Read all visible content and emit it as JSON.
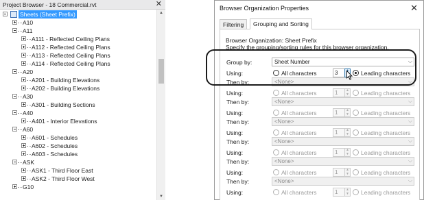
{
  "project_browser": {
    "title": "Project Browser - 18 Commercial.rvt",
    "close_glyph": "✕",
    "root_label": "Sheets (Sheet Prefix)",
    "tree": [
      {
        "label": "A10",
        "level": 1,
        "expanded": false
      },
      {
        "label": "A11",
        "level": 1,
        "expanded": true
      },
      {
        "label": "A111 - Reflected Ceiling Plans",
        "level": 2,
        "expanded": false
      },
      {
        "label": "A112 - Reflected Ceiling Plans",
        "level": 2,
        "expanded": false
      },
      {
        "label": "A113 - Reflected Ceiling Plans",
        "level": 2,
        "expanded": false
      },
      {
        "label": "A114 - Reflected Ceiling Plans",
        "level": 2,
        "expanded": false
      },
      {
        "label": "A20",
        "level": 1,
        "expanded": true
      },
      {
        "label": "A201 - Building Elevations",
        "level": 2,
        "expanded": false
      },
      {
        "label": "A202 - Building Elevations",
        "level": 2,
        "expanded": false
      },
      {
        "label": "A30",
        "level": 1,
        "expanded": true
      },
      {
        "label": "A301 - Building Sections",
        "level": 2,
        "expanded": false
      },
      {
        "label": "A40",
        "level": 1,
        "expanded": true
      },
      {
        "label": "A401 - Interior Elevations",
        "level": 2,
        "expanded": false
      },
      {
        "label": "A60",
        "level": 1,
        "expanded": true
      },
      {
        "label": "A601 - Schedules",
        "level": 2,
        "expanded": false
      },
      {
        "label": "A602 - Schedules",
        "level": 2,
        "expanded": false
      },
      {
        "label": "A603 - Schedules",
        "level": 2,
        "expanded": false
      },
      {
        "label": "ASK",
        "level": 1,
        "expanded": true
      },
      {
        "label": "ASK1 - Third Floor East",
        "level": 2,
        "expanded": false
      },
      {
        "label": "ASK2 - Third Floor West",
        "level": 2,
        "expanded": false
      },
      {
        "label": "G10",
        "level": 1,
        "expanded": false
      }
    ]
  },
  "dialog": {
    "title": "Browser Organization Properties",
    "close_glyph": "✕",
    "tabs": [
      {
        "label": "Filtering",
        "active": false
      },
      {
        "label": "Grouping and Sorting",
        "active": true
      }
    ],
    "description_line1": "Browser Organization: Sheet Prefix",
    "description_line2": "Specify the grouping/sorting rules for this browser organization.",
    "rows": [
      {
        "label": "Group by:",
        "value": "Sheet Number",
        "enabled": true
      },
      {
        "label": "Then by:",
        "value": "<None>",
        "enabled": false
      },
      {
        "label": "Then by:",
        "value": "<None>",
        "enabled": false
      },
      {
        "label": "Then by:",
        "value": "<None>",
        "enabled": false
      },
      {
        "label": "Then by:",
        "value": "<None>",
        "enabled": false
      },
      {
        "label": "Then by:",
        "value": "<None>",
        "enabled": false
      },
      {
        "label": "Then by:",
        "value": "<None>",
        "enabled": false
      }
    ],
    "using_rows": [
      {
        "label": "Using:",
        "all_label": "All characters",
        "count": "3",
        "leading_label": "Leading characters",
        "enabled": true,
        "selected": "leading"
      },
      {
        "label": "Using:",
        "all_label": "All characters",
        "count": "1",
        "leading_label": "Leading characters",
        "enabled": false,
        "selected": "all"
      },
      {
        "label": "Using:",
        "all_label": "All characters",
        "count": "1",
        "leading_label": "Leading characters",
        "enabled": false,
        "selected": "all"
      },
      {
        "label": "Using:",
        "all_label": "All characters",
        "count": "1",
        "leading_label": "Leading characters",
        "enabled": false,
        "selected": "all"
      },
      {
        "label": "Using:",
        "all_label": "All characters",
        "count": "1",
        "leading_label": "Leading characters",
        "enabled": false,
        "selected": "all"
      },
      {
        "label": "Using:",
        "all_label": "All characters",
        "count": "1",
        "leading_label": "Leading characters",
        "enabled": false,
        "selected": "all"
      },
      {
        "label": "Using:",
        "all_label": "All characters",
        "count": "1",
        "leading_label": "Leading characters",
        "enabled": false,
        "selected": "all"
      }
    ]
  },
  "colors": {
    "selection": "#3399ff",
    "annotation": "#1a1a1a"
  }
}
